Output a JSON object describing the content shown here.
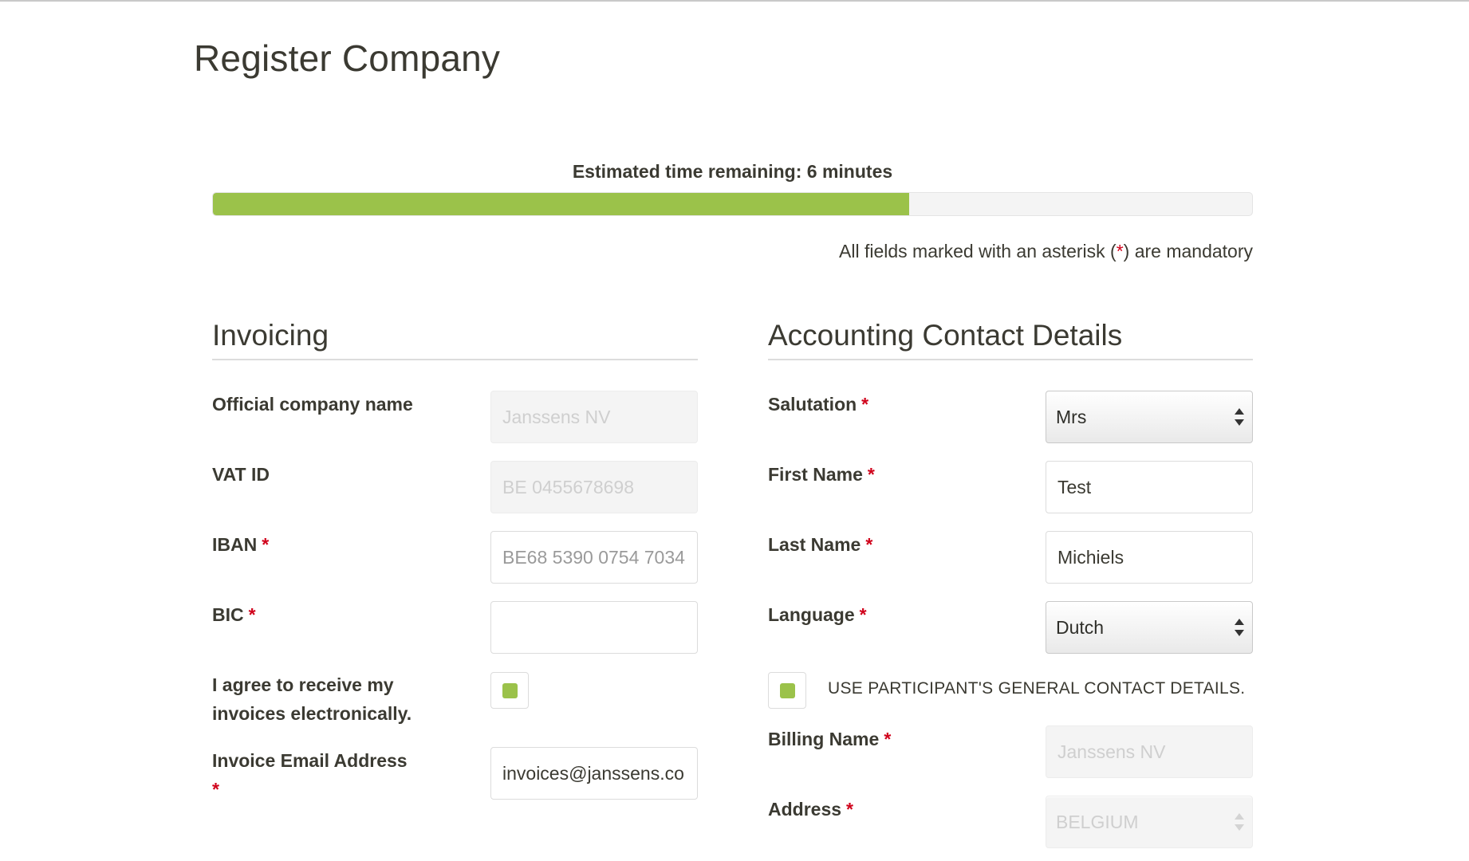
{
  "page": {
    "title": "Register Company"
  },
  "progress": {
    "label": "Estimated time remaining: 6 minutes",
    "percent": 67
  },
  "notice": {
    "before": "All fields marked with an asterisk (",
    "asterisk": "*",
    "after": ") are mandatory"
  },
  "invoicing": {
    "title": "Invoicing",
    "company_name": {
      "label": "Official company name",
      "value": "Janssens NV"
    },
    "vat_id": {
      "label": "VAT ID",
      "value": "BE 0455678698"
    },
    "iban": {
      "label": "IBAN",
      "required": "*",
      "value": "BE68 5390 0754 7034"
    },
    "bic": {
      "label": "BIC",
      "required": "*",
      "value": ""
    },
    "e_invoice": {
      "label_line1": "I agree to receive my",
      "label_line2": "invoices electronically.",
      "checked": true
    },
    "email": {
      "label": "Invoice Email Address",
      "required": "*",
      "value": "invoices@janssens.co"
    }
  },
  "accounting": {
    "title": "Accounting Contact Details",
    "salutation": {
      "label": "Salutation",
      "required": "*",
      "value": "Mrs"
    },
    "first_name": {
      "label": "First Name",
      "required": "*",
      "value": "Test"
    },
    "last_name": {
      "label": "Last Name",
      "required": "*",
      "value": "Michiels"
    },
    "language": {
      "label": "Language",
      "required": "*",
      "value": "Dutch"
    },
    "use_general": {
      "label": "USE PARTICIPANT'S GENERAL CONTACT DETAILS.",
      "checked": true
    },
    "billing_name": {
      "label": "Billing Name",
      "required": "*",
      "value": "Janssens NV"
    },
    "address": {
      "label": "Address",
      "required": "*",
      "value": "BELGIUM"
    }
  },
  "colors": {
    "accent": "#9bc24a",
    "required": "#d0021b",
    "text": "#3b3a32"
  },
  "icons": {
    "select_caret": "updown-caret-icon"
  }
}
